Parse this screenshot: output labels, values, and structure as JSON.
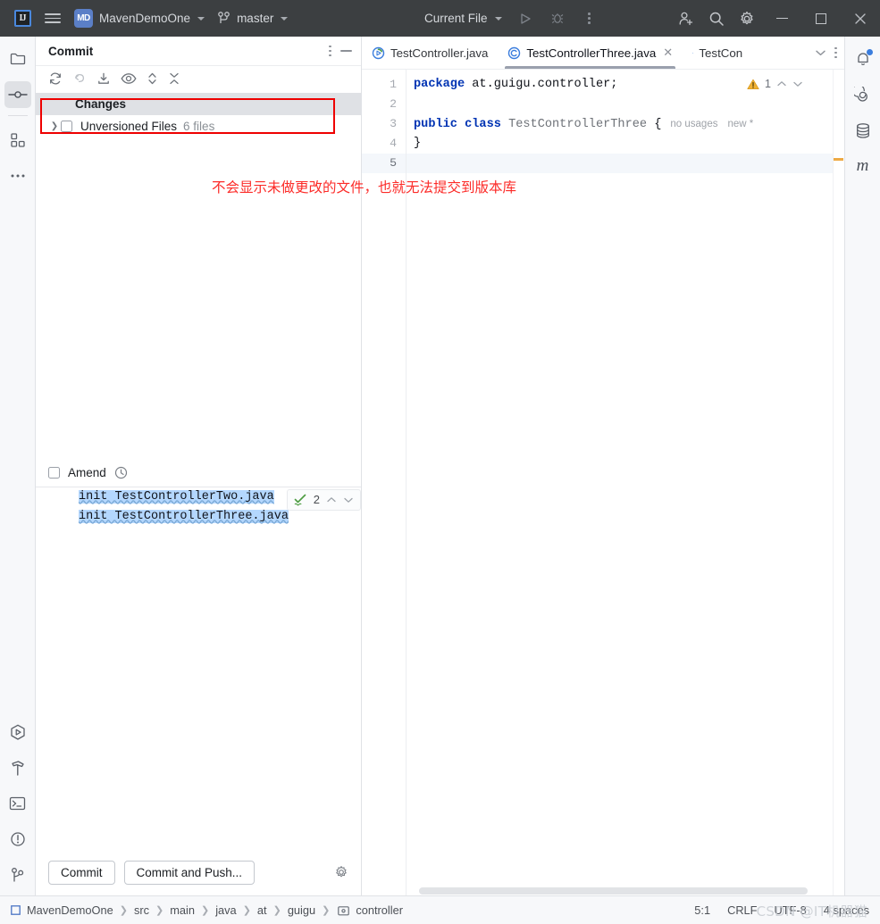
{
  "titlebar": {
    "logo": "IJ",
    "menu_icon": "hamburger-icon",
    "project_badge": "MD",
    "project_name": "MavenDemoOne",
    "branch_icon": "git-branch-icon",
    "branch_name": "master",
    "run_config": "Current File",
    "run_icon": "run-icon",
    "debug_icon": "debug-icon",
    "more_icon": "more-vertical-icon",
    "add_user_icon": "add-user-icon",
    "search_icon": "search-icon",
    "settings_icon": "gear-icon",
    "minimize": "minimize-icon",
    "maximize": "maximize-icon",
    "close": "close-icon"
  },
  "left_strip": {
    "top_items": [
      {
        "name": "project-tool-window",
        "icon": "folder-icon",
        "active": false
      },
      {
        "name": "commit-tool-window",
        "icon": "commit-icon",
        "active": true
      },
      {
        "name": "structure-tool-window",
        "icon": "structure-icon",
        "active": false
      },
      {
        "name": "more-tool-windows",
        "icon": "more-horizontal-icon",
        "active": false
      }
    ],
    "bottom_items": [
      {
        "name": "run-tool-window",
        "icon": "run-hexagon-icon"
      },
      {
        "name": "build-tool-window",
        "icon": "hammer-icon"
      },
      {
        "name": "terminal-tool-window",
        "icon": "terminal-icon"
      },
      {
        "name": "problems-tool-window",
        "icon": "exclamation-circle-icon"
      },
      {
        "name": "git-tool-window",
        "icon": "git-branch-icon"
      }
    ]
  },
  "right_strip": {
    "items": [
      {
        "name": "notifications",
        "icon": "bell-icon",
        "has_badge": true
      },
      {
        "name": "ai-assistant",
        "icon": "spiral-icon",
        "has_badge": false
      },
      {
        "name": "database",
        "icon": "database-icon",
        "has_badge": false
      },
      {
        "name": "maven",
        "icon": "maven-m-icon",
        "has_badge": false
      }
    ]
  },
  "commit_panel": {
    "title": "Commit",
    "header_more_icon": "more-vertical-icon",
    "header_minimize_icon": "minimize-icon",
    "toolbar": [
      {
        "name": "refresh-changes-button",
        "icon": "refresh-icon"
      },
      {
        "name": "rollback-button",
        "icon": "rollback-icon"
      },
      {
        "name": "update-project-button",
        "icon": "download-icon"
      },
      {
        "name": "show-diff-button",
        "icon": "eye-icon"
      },
      {
        "name": "expand-collapse-button",
        "icon": "expand-collapse-icon"
      },
      {
        "name": "collapse-all-button",
        "icon": "collapse-all-icon"
      }
    ],
    "tree": {
      "changes_label": "Changes",
      "unversioned_label": "Unversioned Files",
      "unversioned_count": "6 files",
      "expand_arrow": "chevron-right-icon"
    },
    "amend": {
      "label": "Amend",
      "history_icon": "clock-icon",
      "checked": false
    },
    "commit_message": {
      "line1": "init TestControllerTwo.java",
      "line2": "init TestControllerThree.java"
    },
    "spellcheck": {
      "icon": "spellcheck-icon",
      "count": "2",
      "prev_icon": "chevron-up-icon",
      "next_icon": "chevron-down-icon"
    },
    "footer": {
      "commit_label": "Commit",
      "commit_and_push_label": "Commit and Push...",
      "settings_icon": "gear-icon"
    }
  },
  "annotation": {
    "text": "不会显示未做更改的文件，也就无法提交到版本库",
    "color": "#fc2b28",
    "rect_color": "#ee0000"
  },
  "editor": {
    "tabs": [
      {
        "label": "TestController.java",
        "icon": "class-running-icon",
        "active": false,
        "closable": false
      },
      {
        "label": "TestControllerThree.java",
        "icon": "class-icon",
        "active": true,
        "closable": true
      },
      {
        "label": "TestCon",
        "icon": "class-icon",
        "active": false,
        "closable": false
      }
    ],
    "tab_overflow_icon": "chevron-down-icon",
    "tab_more_icon": "more-vertical-icon",
    "line_numbers": [
      "1",
      "2",
      "3",
      "4",
      "5"
    ],
    "current_line": 5,
    "code": {
      "l1_kw": "package",
      "l1_rest": " at.guigu.controller;",
      "l2": "",
      "l3_kw": "public class",
      "l3_cls": " TestControllerThree ",
      "l3_brace": "{",
      "l3_hint1": "no usages",
      "l3_hint2": "new *",
      "l4": "}",
      "l5": ""
    },
    "inspection": {
      "warning_icon": "warning-triangle-icon",
      "warning_count": "1",
      "prev_icon": "chevron-up-icon",
      "next_icon": "chevron-down-icon"
    }
  },
  "statusbar": {
    "breadcrumbs": [
      "MavenDemoOne",
      "src",
      "main",
      "java",
      "at",
      "guigu",
      "controller"
    ],
    "project_icon": "module-icon",
    "package_icon": "package-folder-icon",
    "caret_position": "5:1",
    "line_separator": "CRLF",
    "encoding": "UTF-8",
    "indent": "4 spaces",
    "watermark": "CSDN @IT机器猫"
  }
}
